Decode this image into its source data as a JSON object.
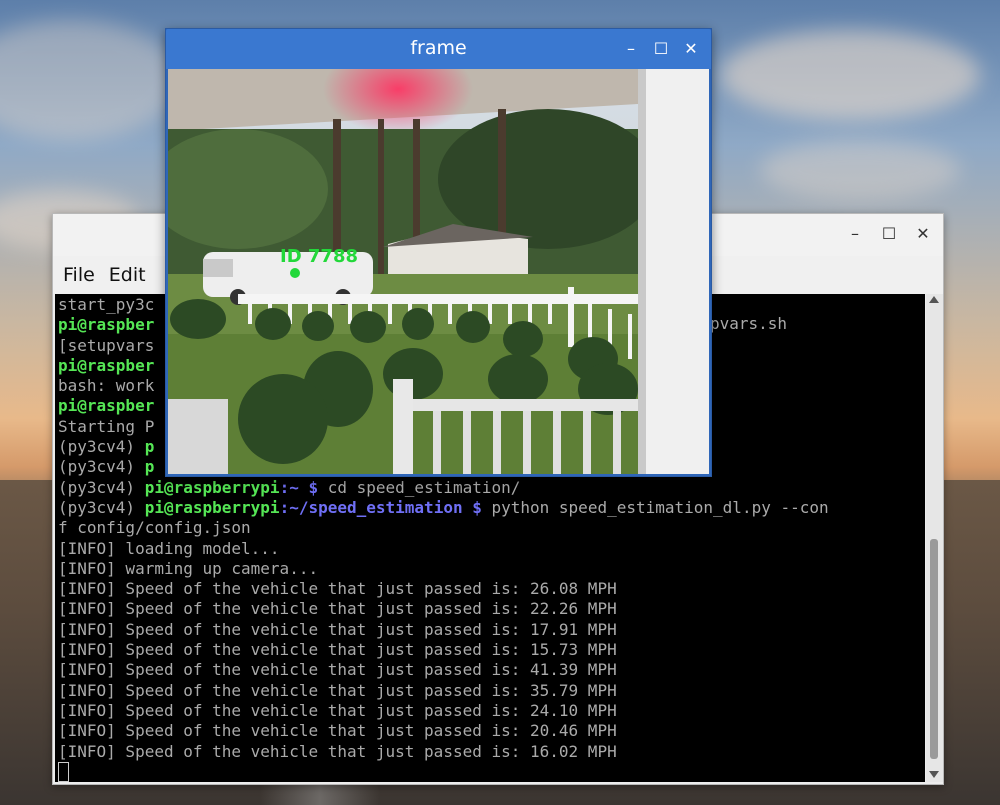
{
  "terminal": {
    "menu": [
      "File",
      "Edit"
    ],
    "lines": [
      [
        {
          "t": "start_py3c",
          "c": "w"
        }
      ],
      [
        {
          "t": "pi@raspber",
          "c": "g"
        }
      ],
      [
        {
          "t": "[setupvars",
          "c": "w"
        }
      ],
      [
        {
          "t": "pi@raspber",
          "c": "g"
        }
      ],
      [
        {
          "t": "bash: work",
          "c": "w"
        }
      ],
      [
        {
          "t": "pi@raspber",
          "c": "g"
        }
      ],
      [
        {
          "t": "Starting P",
          "c": "w"
        }
      ],
      [
        {
          "t": "(py3cv4) ",
          "c": "w"
        },
        {
          "t": "p",
          "c": "g"
        }
      ],
      [
        {
          "t": "(py3cv4) ",
          "c": "w"
        },
        {
          "t": "p",
          "c": "g"
        }
      ],
      [
        {
          "t": "(py3cv4) ",
          "c": "w"
        },
        {
          "t": "pi@raspberrypi",
          "c": "g"
        },
        {
          "t": ":~ ",
          "c": "b"
        },
        {
          "t": "$ ",
          "c": "b"
        },
        {
          "t": "cd speed_estimation/",
          "c": "w"
        }
      ],
      [
        {
          "t": "(py3cv4) ",
          "c": "w"
        },
        {
          "t": "pi@raspberrypi",
          "c": "g"
        },
        {
          "t": ":~/speed_estimation $ ",
          "c": "b"
        },
        {
          "t": "python speed_estimation_dl.py --con",
          "c": "w"
        }
      ],
      [
        {
          "t": "f config/config.json",
          "c": "w"
        }
      ],
      [
        {
          "t": "[INFO] loading model...",
          "c": "w"
        }
      ],
      [
        {
          "t": "[INFO] warming up camera...",
          "c": "w"
        }
      ],
      [
        {
          "t": "[INFO] Speed of the vehicle that just passed is: 26.08 MPH",
          "c": "w"
        }
      ],
      [
        {
          "t": "[INFO] Speed of the vehicle that just passed is: 22.26 MPH",
          "c": "w"
        }
      ],
      [
        {
          "t": "[INFO] Speed of the vehicle that just passed is: 17.91 MPH",
          "c": "w"
        }
      ],
      [
        {
          "t": "[INFO] Speed of the vehicle that just passed is: 15.73 MPH",
          "c": "w"
        }
      ],
      [
        {
          "t": "[INFO] Speed of the vehicle that just passed is: 41.39 MPH",
          "c": "w"
        }
      ],
      [
        {
          "t": "[INFO] Speed of the vehicle that just passed is: 35.79 MPH",
          "c": "w"
        }
      ],
      [
        {
          "t": "[INFO] Speed of the vehicle that just passed is: 24.10 MPH",
          "c": "w"
        }
      ],
      [
        {
          "t": "[INFO] Speed of the vehicle that just passed is: 20.46 MPH",
          "c": "w"
        }
      ],
      [
        {
          "t": "[INFO] Speed of the vehicle that just passed is: 16.02 MPH",
          "c": "w"
        }
      ]
    ],
    "hidden_fragment": "pvars.sh",
    "controls": {
      "minimize": "minimize-icon",
      "maximize": "maximize-icon",
      "close": "close-icon"
    }
  },
  "frame_window": {
    "title": "frame",
    "tracker_label": "ID 7788",
    "label_color": "#22d83a"
  }
}
